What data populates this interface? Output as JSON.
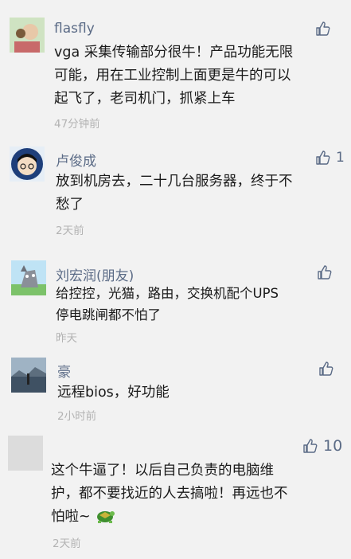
{
  "comments": [
    {
      "name": "flasfly",
      "text": "vga 采集传输部分很牛！产品功能无限\n可能，用在工业控制上面更是牛的可以\n起飞了，老司机门，抓紧上车",
      "time": "47分钟前",
      "likes": ""
    },
    {
      "name": "卢俊成",
      "text": "放到机房去，二十几台服务器，终于不\n愁了",
      "time": "2天前",
      "likes": "1"
    },
    {
      "name": "刘宏润(朋友)",
      "text": "给控控，光猫，路由，交换机配个UPS\n停电跳闸都不怕了",
      "time": "昨天",
      "likes": ""
    },
    {
      "name": "豪",
      "text": "远程bios，好功能",
      "time": "2小时前",
      "likes": ""
    },
    {
      "name": "",
      "text": "这个牛逼了！以后自己负责的电脑维\n护，都不要找近的人去搞啦！再远也不\n怕啦~",
      "time": "2天前",
      "likes": "10"
    }
  ],
  "icons": {
    "like": "thumbs-up-icon",
    "emoji": "turtle-emoji"
  },
  "colors": {
    "name": "#5b6b86",
    "text": "#1a1a1a",
    "time": "#b3b3b3",
    "background": "#f2f2f2"
  }
}
